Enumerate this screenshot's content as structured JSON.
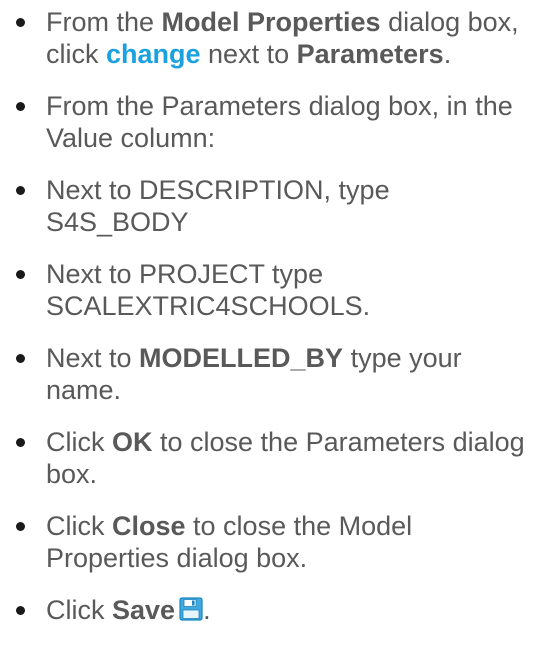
{
  "steps": [
    {
      "t1": "From the ",
      "b1": "Model Properties",
      "t2": " dialog box, click ",
      "link": "change",
      "t3": " next to ",
      "b2": "Parameters",
      "t4": "."
    },
    {
      "text": "From the Parameters dialog box, in the Value column:"
    },
    {
      "text": "Next to DESCRIPTION, type S4S_BODY"
    },
    {
      "text": "Next to PROJECT type SCALEXTRIC4SCHOOLS."
    },
    {
      "t1": "Next to ",
      "b1": "MODELLED_BY",
      "t2": " type your name."
    },
    {
      "t1": "Click ",
      "b1": "OK",
      "t2": " to close the Parameters dialog box."
    },
    {
      "t1": "Click ",
      "b1": "Close",
      "t2": " to close the Model Properties dialog box."
    },
    {
      "t1": "Click ",
      "b1": "Save",
      "t2": "."
    }
  ],
  "colors": {
    "text": "#595959",
    "link": "#1aa1e0",
    "bullet": "#1a1a1a",
    "save_icon": "#3fa9e0"
  },
  "icons": {
    "save": "floppy-disk-icon"
  }
}
